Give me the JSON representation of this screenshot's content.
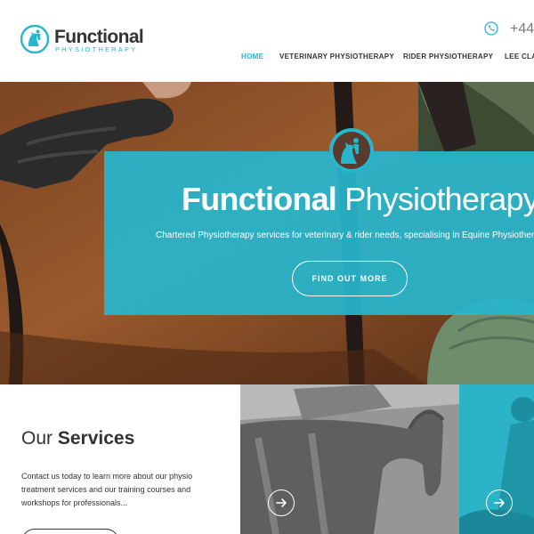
{
  "brand": {
    "name": "Functional",
    "tagline": "PHYSIOTHERAPY",
    "accent_color": "#27b6cc",
    "logo_icon": "horse-rider-logo-icon"
  },
  "header": {
    "phone_prefix": "+44",
    "phone_icon": "phone-icon"
  },
  "nav": {
    "items": [
      {
        "label": "HOME",
        "active": true
      },
      {
        "label": "VETERINARY PHYSIOTHERAPY",
        "active": false
      },
      {
        "label": "RIDER PHYSIOTHERAPY",
        "active": false
      },
      {
        "label": "LEE CLA",
        "active": false
      }
    ]
  },
  "hero": {
    "title_bold": "Functional",
    "title_light": "Physiotherapy",
    "subtitle": "Chartered Physiotherapy services for veterinary & rider needs, specialising in Equine Physiothera",
    "button_label": "FIND OUT MORE",
    "badge_icon": "horse-rider-badge-icon"
  },
  "services": {
    "title_light": "Our",
    "title_bold": "Services",
    "description": "Contact us today to learn more about our physio treatment services and our training courses and workshops for professionals...",
    "cards": [
      {
        "image": "horse-in-rug-photo",
        "arrow_icon": "arrow-right-icon"
      },
      {
        "image": "rider-photo",
        "arrow_icon": "arrow-right-icon"
      }
    ]
  }
}
